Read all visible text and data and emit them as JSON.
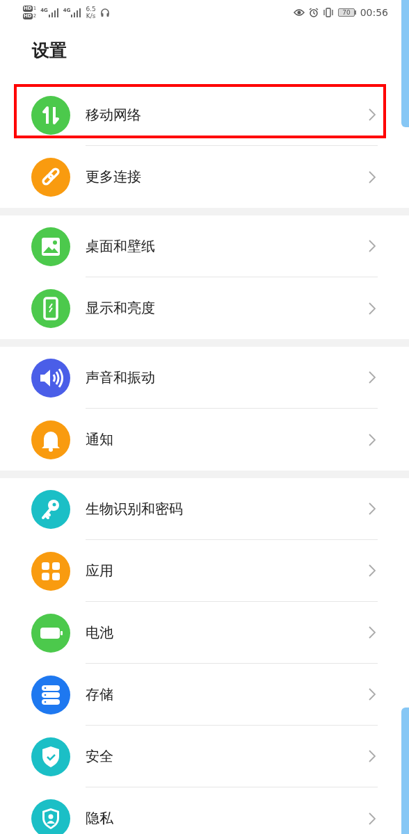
{
  "status_bar": {
    "sim_labels": [
      "HD",
      "HD"
    ],
    "sim_numbers": [
      "1",
      "2"
    ],
    "networks": [
      "4G",
      "4G"
    ],
    "speed_value": "6.5",
    "speed_unit": "K/s",
    "battery": "70",
    "time": "00:56"
  },
  "title": "设置",
  "groups": [
    {
      "items": [
        {
          "label": "移动网络",
          "color": "#4cc94c",
          "highlighted": true
        },
        {
          "label": "更多连接",
          "color": "#f99b0f",
          "highlighted": false
        }
      ]
    },
    {
      "items": [
        {
          "label": "桌面和壁纸",
          "color": "#4cc94c",
          "highlighted": false
        },
        {
          "label": "显示和亮度",
          "color": "#4cc94c",
          "highlighted": false
        }
      ]
    },
    {
      "items": [
        {
          "label": "声音和振动",
          "color": "#4a5ee8",
          "highlighted": false
        },
        {
          "label": "通知",
          "color": "#f99b0f",
          "highlighted": false
        }
      ]
    },
    {
      "items": [
        {
          "label": "生物识别和密码",
          "color": "#1bbfc6",
          "highlighted": false
        },
        {
          "label": "应用",
          "color": "#f99b0f",
          "highlighted": false
        },
        {
          "label": "电池",
          "color": "#4cc94c",
          "highlighted": false
        },
        {
          "label": "存储",
          "color": "#1e78f0",
          "highlighted": false
        },
        {
          "label": "安全",
          "color": "#1bbfc6",
          "highlighted": false
        },
        {
          "label": "隐私",
          "color": "#1bbfc6",
          "highlighted": false
        }
      ]
    }
  ]
}
